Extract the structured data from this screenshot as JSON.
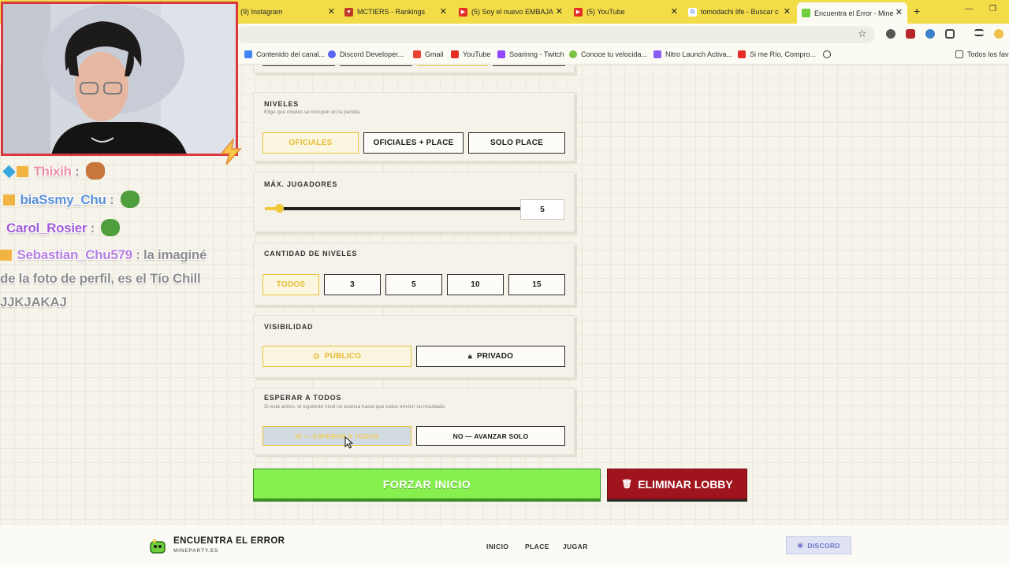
{
  "browser": {
    "tabs": [
      {
        "label": "(9) Instagram",
        "favicon": "instagram-icon"
      },
      {
        "label": "MCTIERS - Rankings",
        "favicon": "mctiers-icon"
      },
      {
        "label": "(5) Soy el nuevo EMBAJA",
        "favicon": "youtube-icon"
      },
      {
        "label": "(5) YouTube",
        "favicon": "youtube-icon"
      },
      {
        "label": "tomodachi life - Buscar c",
        "favicon": "google-icon"
      },
      {
        "label": "Encuentra el Error - Mine",
        "favicon": "mineparty-icon",
        "active": true
      }
    ],
    "new_tab": "+",
    "bookmarks": [
      {
        "label": "Contenido del canal...",
        "favicon": "google-icon"
      },
      {
        "label": "Discord Developer...",
        "favicon": "discord-icon"
      },
      {
        "label": "Gmail",
        "favicon": "gmail-icon"
      },
      {
        "label": "YouTube",
        "favicon": "youtube-icon"
      },
      {
        "label": "Soarinng - Twitch",
        "favicon": "twitch-icon"
      },
      {
        "label": "Conoce tu velocida...",
        "favicon": "speedtest-icon"
      },
      {
        "label": "Nitro Launch Activa...",
        "favicon": "nitro-icon"
      },
      {
        "label": "Si me Río, Compro...",
        "favicon": "youtube-icon"
      }
    ],
    "all_bookmarks": "Todos los fav"
  },
  "settings": {
    "niveles": {
      "title": "NIVELES",
      "subtitle": "Elige qué niveles se incluyen en la partida.",
      "options": [
        "OFICIALES",
        "OFICIALES + PLACE",
        "SOLO PLACE"
      ],
      "selected": "OFICIALES"
    },
    "max_jugadores": {
      "title": "MÁX. JUGADORES",
      "value": "5",
      "fill_fraction": 0.04
    },
    "cantidad_niveles": {
      "title": "CANTIDAD DE NIVELES",
      "options": [
        "TODOS",
        "3",
        "5",
        "10",
        "15"
      ],
      "selected": "TODOS"
    },
    "visibilidad": {
      "title": "VISIBILIDAD",
      "options": [
        "PÚBLICO",
        "PRIVADO"
      ],
      "selected": "PÚBLICO"
    },
    "esperar": {
      "title": "ESPERAR A TODOS",
      "subtitle": "Si está activo, el siguiente nivel no avanza hasta que todos envíen su resultado.",
      "options": [
        "SÍ — ESPERAR A TODOS",
        "NO — AVANZAR SOLO"
      ],
      "selected": "SÍ — ESPERAR A TODOS"
    }
  },
  "actions": {
    "force_start": "FORZAR INICIO",
    "delete_lobby": "ELIMINAR LOBBY"
  },
  "footer": {
    "brand": "ENCUENTRA EL ERROR",
    "domain": "MINEPARTY.ES",
    "nav": [
      "INICIO",
      "PLACE",
      "JUGAR"
    ],
    "discord": "DISCORD"
  },
  "stream_chat": [
    {
      "user": "Thixih",
      "sep": " :",
      "color": "#e98fa6",
      "message": ""
    },
    {
      "user": "biaSsmy_Chu",
      "sep": " :",
      "color": "#5b8fd6",
      "message": ""
    },
    {
      "user": "Carol_Rosier",
      "sep": " :",
      "color": "#a05ad6",
      "message": ""
    },
    {
      "user": "Sebastian_Chu579",
      "sep": " :",
      "color": "#b57ee0",
      "message": " la imaginé"
    },
    {
      "user": "",
      "sep": "",
      "color": "#8c8c8c",
      "message": "de la foto de perfil, es el Tío Chill"
    },
    {
      "user": "",
      "sep": "",
      "color": "#8c8c8c",
      "message": "JJKJAKAJ"
    }
  ],
  "colors": {
    "tabbar": "#f2dc47",
    "accent_yellow": "#e9c23c",
    "force_green": "#86f04e",
    "delete_red": "#a0141e",
    "webcam_border": "#d7393f"
  }
}
